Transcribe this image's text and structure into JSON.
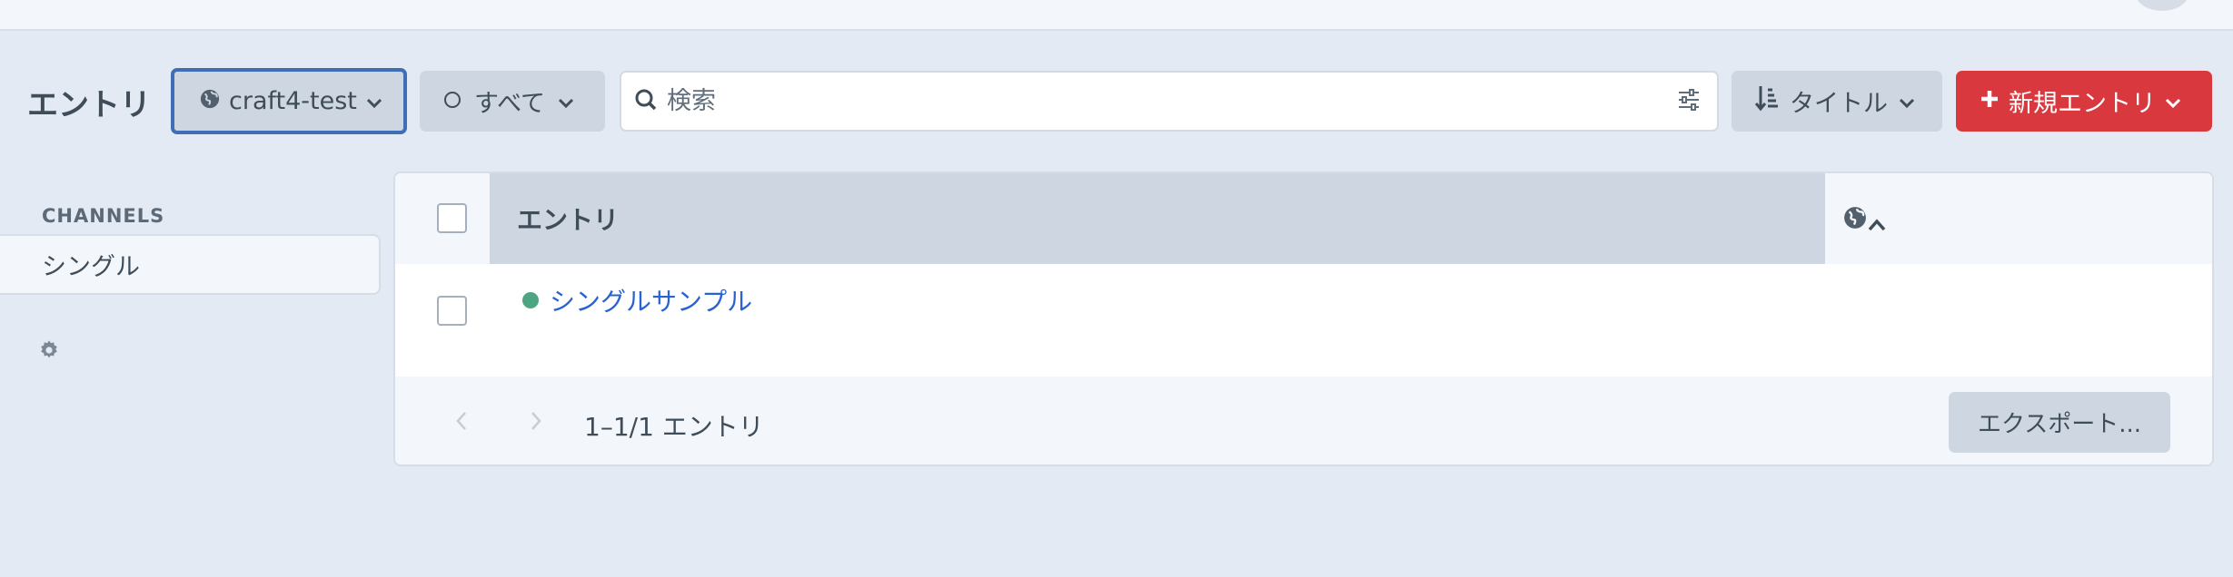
{
  "page": {
    "title": "エントリ"
  },
  "toolbar": {
    "site_label": "craft4-test",
    "status_label": "すべて",
    "search_placeholder": "検索",
    "sort_label": "タイトル",
    "new_label": "新規エントリ"
  },
  "sidebar": {
    "heading": "CHANNELS",
    "items": [
      {
        "label": "シングル"
      }
    ]
  },
  "table": {
    "column_title": "エントリ",
    "rows": [
      {
        "title": "シングルサンプル",
        "status": "live"
      }
    ]
  },
  "footer": {
    "count_text": "1–1/1 エントリ",
    "export_label": "エクスポート..."
  },
  "colors": {
    "accent": "#3f6db6",
    "new_button": "#d9393e",
    "status_live": "#4fa581",
    "link": "#2a62d4"
  },
  "icons": {
    "site": "globe-icon",
    "status": "circle-icon",
    "search": "search-icon",
    "filter": "sliders-icon",
    "sort": "sort-icon",
    "new": "plus-icon",
    "settings": "gear-icon"
  }
}
